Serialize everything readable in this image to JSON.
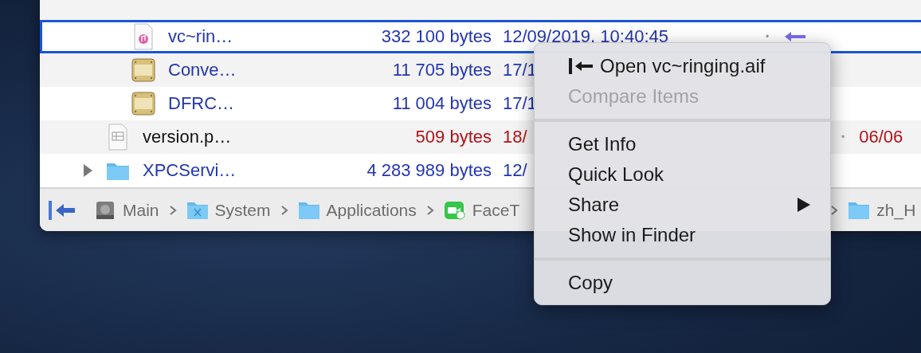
{
  "file_list": {
    "rows": [
      {
        "children": [
          {
            "kind": "audio",
            "name": "vc~rin…",
            "size": "332 100 bytes",
            "date": "12/09/2019, 10:40:45",
            "selected": true,
            "color": "#2236b0",
            "column_4": "•",
            "alias_arrow": true
          },
          {
            "kind": "bundle",
            "name": "Conve…",
            "size": "11 705 bytes",
            "date": "17/1",
            "selected": false,
            "color": "#2236b0"
          },
          {
            "kind": "bundle",
            "name": "DFRC…",
            "size": "11 004 bytes",
            "date": "17/1",
            "selected": false,
            "color": "#2236b0"
          }
        ]
      },
      {
        "kind": "plist",
        "name": "version.p…",
        "size": "509 bytes",
        "date": "18/",
        "selected": false,
        "color": "#b01318",
        "plain_name": true,
        "column_5": "•",
        "column_6": "06/06"
      },
      {
        "kind": "folder",
        "name": "XPCServi…",
        "size": "4 283 989 bytes",
        "date": "12/",
        "selected": false,
        "expanded": false,
        "color": "#2236b0"
      }
    ]
  },
  "path_bar": {
    "items": [
      {
        "kind": "disk",
        "label": "Main"
      },
      {
        "kind": "system-folder",
        "label": "System"
      },
      {
        "kind": "folder",
        "label": "Applications"
      },
      {
        "kind": "app",
        "label": "FaceT"
      }
    ],
    "trailing": {
      "kind": "folder",
      "label": "zh_H"
    }
  },
  "context_menu": {
    "items": [
      {
        "kind": "item",
        "label": "Open vc~ringing.aif",
        "icon": true,
        "disabled": false
      },
      {
        "kind": "item",
        "label": "Compare Items",
        "disabled": true
      },
      {
        "kind": "separator"
      },
      {
        "kind": "item",
        "label": "Get Info",
        "disabled": false
      },
      {
        "kind": "item",
        "label": "Quick Look",
        "disabled": false
      },
      {
        "kind": "item",
        "label": "Share",
        "disabled": false,
        "submenu": true
      },
      {
        "kind": "item",
        "label": "Show in Finder",
        "disabled": false
      },
      {
        "kind": "separator"
      },
      {
        "kind": "item",
        "label": "Copy",
        "disabled": false
      }
    ]
  }
}
